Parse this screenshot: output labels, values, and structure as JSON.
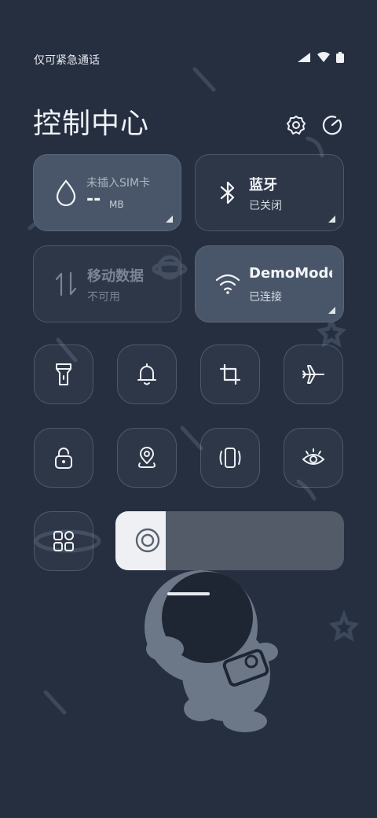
{
  "status_bar": {
    "carrier": "仅可紧急通话"
  },
  "header": {
    "title": "控制中心"
  },
  "tiles": {
    "data_usage": {
      "line1": "未插入SIM卡",
      "value": "--",
      "unit": "MB"
    },
    "bluetooth": {
      "title": "蓝牙",
      "status": "已关闭"
    },
    "mobile_data": {
      "title": "移动数据",
      "status": "不可用"
    },
    "wifi": {
      "title": "DemoMode",
      "status": "已连接"
    }
  },
  "toggles": [
    "flashlight-icon",
    "bell-icon",
    "crop-icon",
    "airplane-icon",
    "lock-icon",
    "location-icon",
    "vibrate-icon",
    "eye-icon",
    "apps-icon"
  ],
  "brightness": {
    "level": 0.22
  },
  "colors": {
    "background": "#262f40",
    "tile_on": "#495669",
    "slider_track": "#535b68",
    "slider_fill": "#eef0f3"
  }
}
